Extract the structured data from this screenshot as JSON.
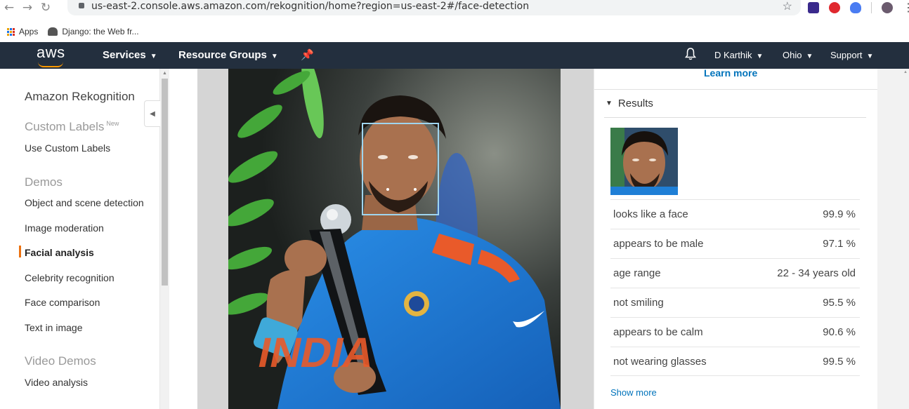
{
  "browser": {
    "url": "us-east-2.console.aws.amazon.com/rekognition/home?region=us-east-2#/face-detection",
    "bookmarks": [
      "Apps",
      "Django: the Web fr..."
    ]
  },
  "awsnav": {
    "logo_text": "aws",
    "services": "Services",
    "resource_groups": "Resource Groups",
    "user": "D Karthik",
    "region": "Ohio",
    "support": "Support"
  },
  "sidebar": {
    "title": "Amazon Rekognition",
    "custom_labels_header": "Custom Labels",
    "custom_labels_badge": "New",
    "use_custom_labels": "Use Custom Labels",
    "demos_header": "Demos",
    "demos": [
      "Object and scene detection",
      "Image moderation",
      "Facial analysis",
      "Celebrity recognition",
      "Face comparison",
      "Text in image"
    ],
    "video_demos_header": "Video Demos",
    "video_analysis": "Video analysis"
  },
  "panel": {
    "learn_more": "Learn more",
    "results_label": "Results",
    "results": [
      {
        "label": "looks like a face",
        "value": "99.9 %"
      },
      {
        "label": "appears to be male",
        "value": "97.1 %"
      },
      {
        "label": "age range",
        "value": "22 - 34 years old"
      },
      {
        "label": "not smiling",
        "value": "95.5 %"
      },
      {
        "label": "appears to be calm",
        "value": "90.6 %"
      },
      {
        "label": "not wearing glasses",
        "value": "99.5 %"
      }
    ],
    "show_more": "Show more"
  },
  "photo": {
    "jersey_text": "INDIA"
  },
  "colors": {
    "aws_nav": "#232f3e",
    "aws_orange": "#ff9900",
    "active_marker": "#ec7211",
    "link_blue": "#0073bb",
    "face_box": "#9fd5ef",
    "jersey_blue": "#1f7fd6"
  }
}
